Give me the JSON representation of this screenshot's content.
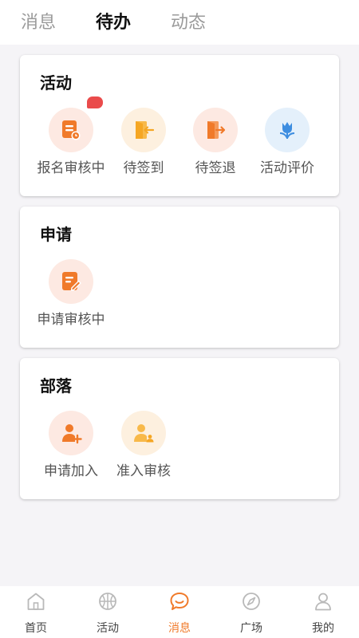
{
  "tabs": [
    {
      "label": "消息"
    },
    {
      "label": "待办"
    },
    {
      "label": "动态"
    }
  ],
  "sections": {
    "activity": {
      "title": "活动",
      "items": [
        {
          "label": "报名审核中",
          "icon": "form-review-icon",
          "has_badge": true
        },
        {
          "label": "待签到",
          "icon": "door-enter-icon"
        },
        {
          "label": "待签退",
          "icon": "door-exit-icon"
        },
        {
          "label": "活动评价",
          "icon": "tulip-icon"
        }
      ]
    },
    "application": {
      "title": "申请",
      "items": [
        {
          "label": "申请审核中",
          "icon": "document-edit-icon"
        }
      ]
    },
    "tribe": {
      "title": "部落",
      "items": [
        {
          "label": "申请加入",
          "icon": "user-add-icon"
        },
        {
          "label": "准入审核",
          "icon": "user-review-icon"
        }
      ]
    }
  },
  "bottom_nav": [
    {
      "label": "首页",
      "icon": "home-icon"
    },
    {
      "label": "活动",
      "icon": "basketball-icon"
    },
    {
      "label": "消息",
      "icon": "chat-bubble-icon",
      "active": true
    },
    {
      "label": "广场",
      "icon": "compass-icon"
    },
    {
      "label": "我的",
      "icon": "person-icon"
    }
  ],
  "colors": {
    "accent": "#f07a2a",
    "badge": "#ea4b4b",
    "background": "#f5f4f7"
  }
}
